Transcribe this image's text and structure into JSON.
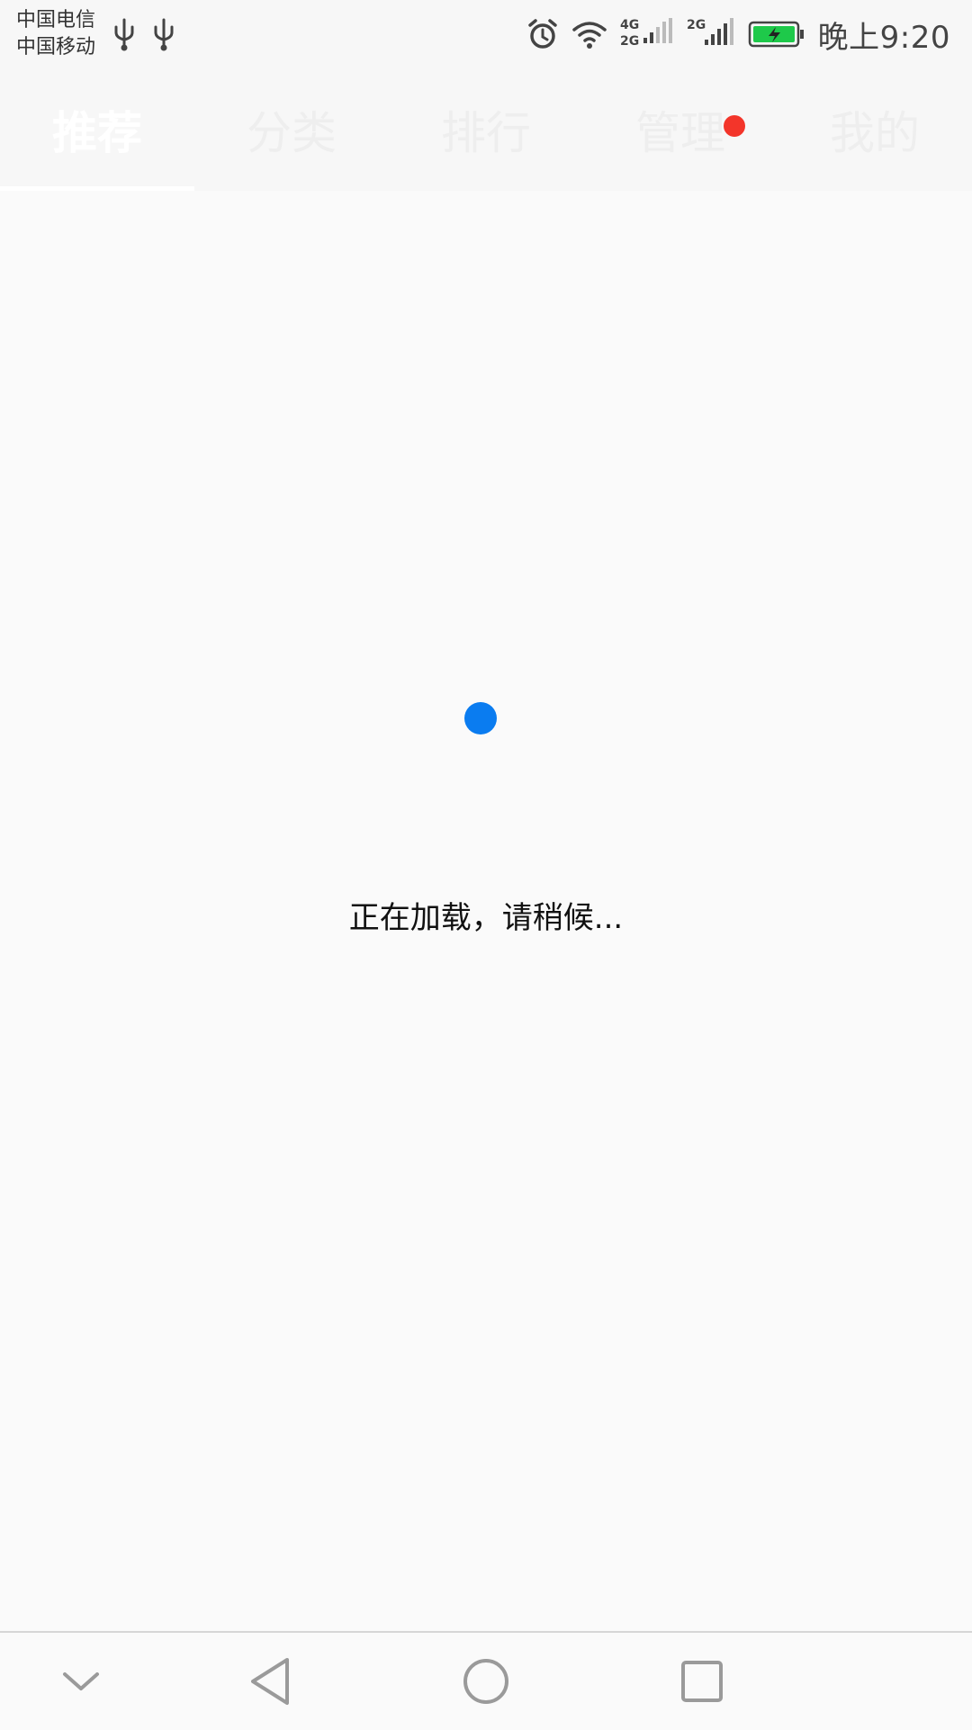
{
  "status_bar": {
    "carrier_1": "中国电信",
    "carrier_2": "中国移动",
    "time": "晚上9:20",
    "icons": [
      "usb-icon",
      "usb-icon",
      "alarm-icon",
      "wifi-icon",
      "signal-4g-2g-icon",
      "signal-2g-icon",
      "battery-charging-icon"
    ],
    "net_label_1a": "4G",
    "net_label_1b": "2G",
    "net_label_2": "2G"
  },
  "tabs": [
    {
      "label": "推荐",
      "active": true
    },
    {
      "label": "分类",
      "active": false
    },
    {
      "label": "排行",
      "active": false
    },
    {
      "label": "管理",
      "active": false,
      "badge": true
    },
    {
      "label": "我的",
      "active": false
    }
  ],
  "loading": {
    "text": "正在加载，请稍候..."
  },
  "nav_bar": {
    "icons": [
      "hide-nav-icon",
      "back-icon",
      "home-icon",
      "recents-icon"
    ]
  },
  "colors": {
    "accent": "#0a7cf0",
    "badge": "#f3352a",
    "battery": "#1ec94a"
  }
}
